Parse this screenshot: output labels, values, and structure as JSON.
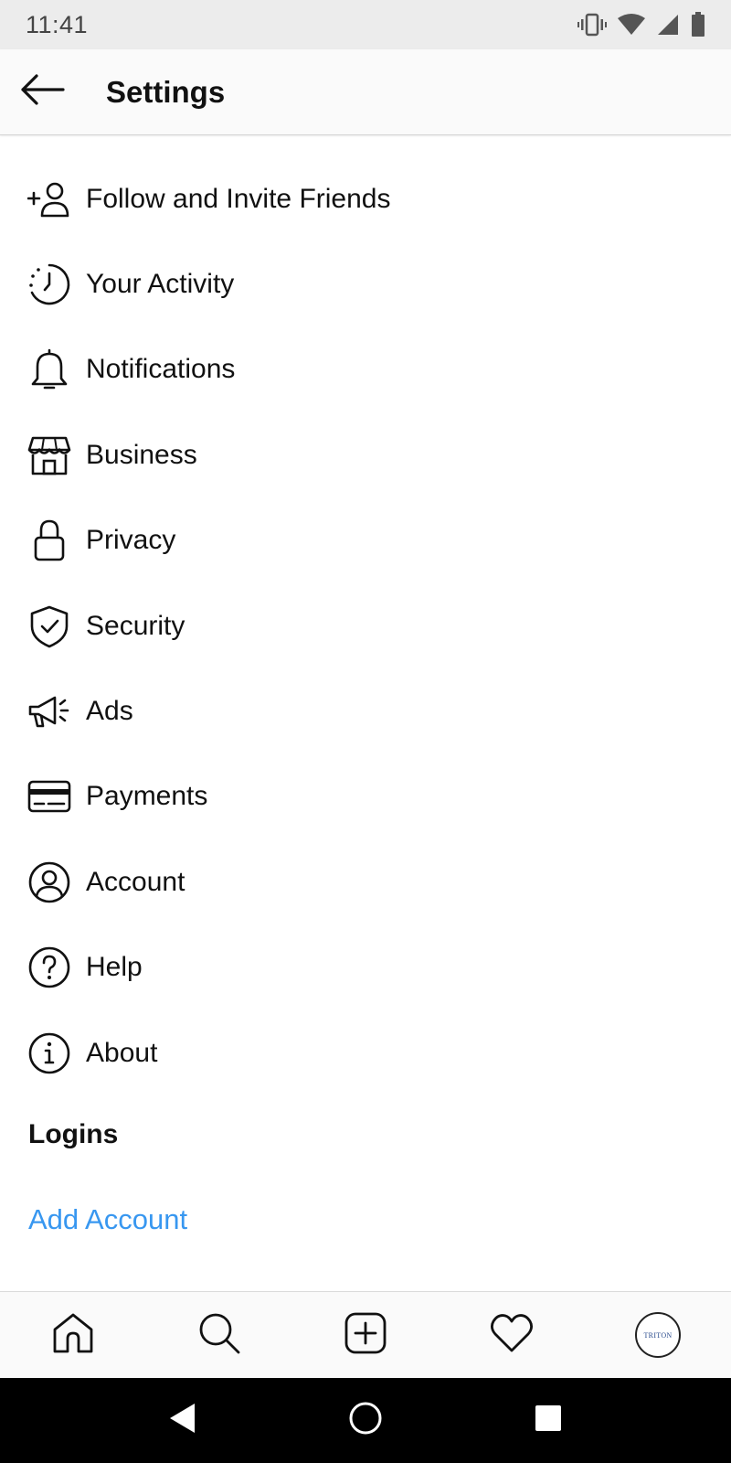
{
  "status_bar": {
    "time": "11:41"
  },
  "header": {
    "title": "Settings"
  },
  "settings": {
    "items": [
      {
        "label": "Follow and Invite Friends",
        "icon": "add-person-icon"
      },
      {
        "label": "Your Activity",
        "icon": "activity-clock-icon"
      },
      {
        "label": "Notifications",
        "icon": "bell-icon"
      },
      {
        "label": "Business",
        "icon": "storefront-icon"
      },
      {
        "label": "Privacy",
        "icon": "lock-icon"
      },
      {
        "label": "Security",
        "icon": "shield-check-icon"
      },
      {
        "label": "Ads",
        "icon": "megaphone-icon"
      },
      {
        "label": "Payments",
        "icon": "credit-card-icon"
      },
      {
        "label": "Account",
        "icon": "account-circle-icon"
      },
      {
        "label": "Help",
        "icon": "help-circle-icon"
      },
      {
        "label": "About",
        "icon": "info-circle-icon"
      }
    ]
  },
  "logins": {
    "header": "Logins",
    "add_account_label": "Add Account"
  },
  "bottom_nav": {
    "items": [
      "home-icon",
      "search-icon",
      "new-post-icon",
      "activity-heart-icon",
      "profile-avatar"
    ],
    "avatar_text": "TRITON"
  },
  "colors": {
    "link": "#3897f0",
    "text": "#111111",
    "status_bar_bg": "#ececec",
    "app_bar_bg": "#fafafa"
  }
}
